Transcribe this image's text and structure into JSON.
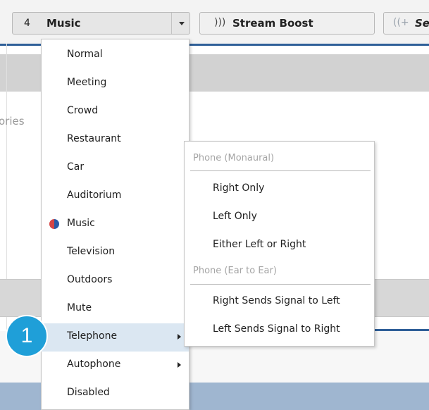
{
  "toolbar": {
    "program_number": "4",
    "program_name": "Music",
    "stream_boost_label": "Stream Boost",
    "third_button_label": "Se"
  },
  "background": {
    "side_text": "ories"
  },
  "program_menu": {
    "items": [
      {
        "label": "Normal"
      },
      {
        "label": "Meeting"
      },
      {
        "label": "Crowd"
      },
      {
        "label": "Restaurant"
      },
      {
        "label": "Car"
      },
      {
        "label": "Auditorium"
      },
      {
        "label": "Music",
        "selected": true
      },
      {
        "label": "Television"
      },
      {
        "label": "Outdoors"
      },
      {
        "label": "Mute"
      },
      {
        "label": "Telephone",
        "has_submenu": true,
        "highlighted": true
      },
      {
        "label": "Autophone",
        "has_submenu": true
      },
      {
        "label": "Disabled"
      }
    ]
  },
  "telephone_submenu": {
    "monaural_header": "Phone (Monaural)",
    "monaural_items": [
      "Right Only",
      "Left Only",
      "Either Left or Right"
    ],
    "ear_to_ear_header": "Phone (Ear to Ear)",
    "ear_to_ear_items": [
      "Right Sends Signal to Left",
      "Left Sends Signal to Right"
    ]
  },
  "callout": {
    "number": "1"
  },
  "colors": {
    "accent_blue": "#2f5f98",
    "highlight": "#dbe7f2",
    "badge": "#1f9fd8"
  }
}
